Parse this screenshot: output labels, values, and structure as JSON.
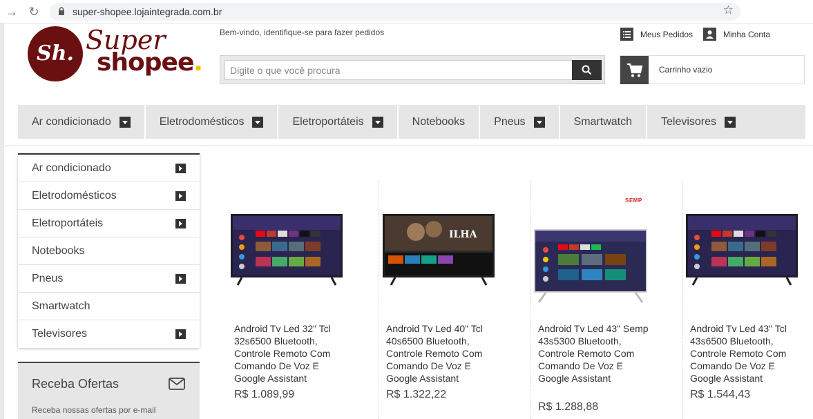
{
  "browser": {
    "url": "super-shopee.lojaintegrada.com.br"
  },
  "header": {
    "logo_monogram": "Sh.",
    "logo_line1": "Super",
    "logo_line2": "shopee",
    "logo_dot": ".",
    "welcome_text": "Bem-vindo, identifique-se para fazer pedidos",
    "search_placeholder": "Digite o que você procura",
    "my_orders": "Meus Pedidos",
    "my_account": "Minha Conta",
    "cart_label": "Carrinho vazio"
  },
  "categories": [
    {
      "label": "Ar condicionado",
      "has_submenu": true
    },
    {
      "label": "Eletrodomésticos",
      "has_submenu": true
    },
    {
      "label": "Eletroportáteis",
      "has_submenu": true
    },
    {
      "label": "Notebooks",
      "has_submenu": false
    },
    {
      "label": "Pneus",
      "has_submenu": true
    },
    {
      "label": "Smartwatch",
      "has_submenu": false
    },
    {
      "label": "Televisores",
      "has_submenu": true
    }
  ],
  "sidebar": {
    "items": [
      {
        "label": "Ar condicionado",
        "has_submenu": true
      },
      {
        "label": "Eletrodomésticos",
        "has_submenu": true
      },
      {
        "label": "Eletroportáteis",
        "has_submenu": true
      },
      {
        "label": "Notebooks",
        "has_submenu": false
      },
      {
        "label": "Pneus",
        "has_submenu": true
      },
      {
        "label": "Smartwatch",
        "has_submenu": false
      },
      {
        "label": "Televisores",
        "has_submenu": true
      }
    ],
    "offers_title": "Receba Ofertas",
    "offers_subtitle": "Receba nossas ofertas por e-mail"
  },
  "products": [
    {
      "name": "Android Tv Led 32\" Tcl 32s6500 Bluetooth, Controle Remoto Com Comando De Voz E Google Assistant",
      "price": "R$ 1.089,99"
    },
    {
      "name": "Android Tv Led 40\" Tcl 40s6500 Bluetooth, Controle Remoto Com Comando De Voz E Google Assistant",
      "price": "R$ 1.322,22"
    },
    {
      "name": "Android Tv Led 43\" Semp 43s5300 Bluetooth, Controle Remoto Com Comando De Voz E Google Assistant",
      "price": "R$ 1.288,88",
      "brand_mark": "SEMP"
    },
    {
      "name": "Android Tv Led 43\" Tcl 43s6500 Bluetooth, Controle Remoto Com Comando De Voz E Google Assistant",
      "price": "R$ 1.544,43"
    }
  ],
  "colors": {
    "brand": "#6b1010",
    "accent_dot": "#f0c400",
    "nav_bg": "#e6e6e6",
    "dark_button": "#333333"
  }
}
